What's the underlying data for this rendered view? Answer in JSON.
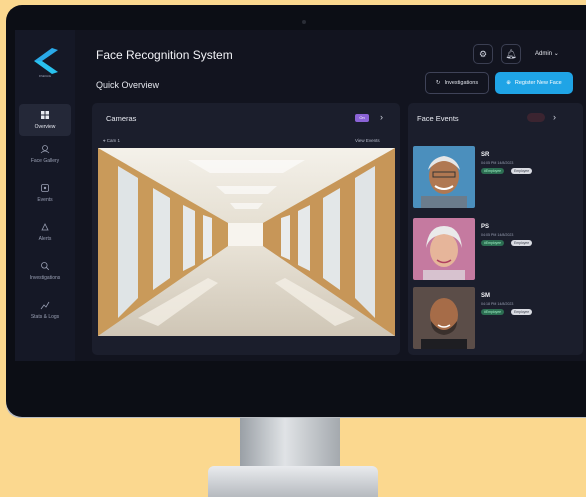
{
  "app": {
    "title": "Face Recognition System",
    "subtitle": "Quick Overview",
    "admin_label": "Admin"
  },
  "sidebar": {
    "items": [
      {
        "label": "Overview",
        "icon": "grid-icon",
        "active": true
      },
      {
        "label": "Face Gallery",
        "icon": "face-icon"
      },
      {
        "label": "Events",
        "icon": "events-icon"
      },
      {
        "label": "Alerts",
        "icon": "alert-icon"
      },
      {
        "label": "Investigations",
        "icon": "search-icon"
      },
      {
        "label": "Stats & Logs",
        "icon": "stats-icon"
      }
    ]
  },
  "header": {
    "investigations_label": "Investigations",
    "register_label": "Register New Face"
  },
  "cameras": {
    "title": "Cameras",
    "toggle_label": "On",
    "cam_label": "Cam 1",
    "view_label": "View Events"
  },
  "face_events": {
    "title": "Face Events",
    "items": [
      {
        "initials": "SR",
        "date": "04:05 PM 14/8/2023",
        "tags": [
          "#Employee",
          "Employee"
        ]
      },
      {
        "initials": "PS",
        "date": "04:05 PM 14/8/2023",
        "tags": [
          "#Employee",
          "Employee"
        ]
      },
      {
        "initials": "SM",
        "date": "04:18 PM 14/8/2023",
        "tags": [
          "#Employee",
          "Employee"
        ]
      }
    ]
  },
  "colors": {
    "accent": "#1fa4e6",
    "purple": "#8b63d6",
    "background": "#12141f",
    "wall": "#fbd88f"
  }
}
